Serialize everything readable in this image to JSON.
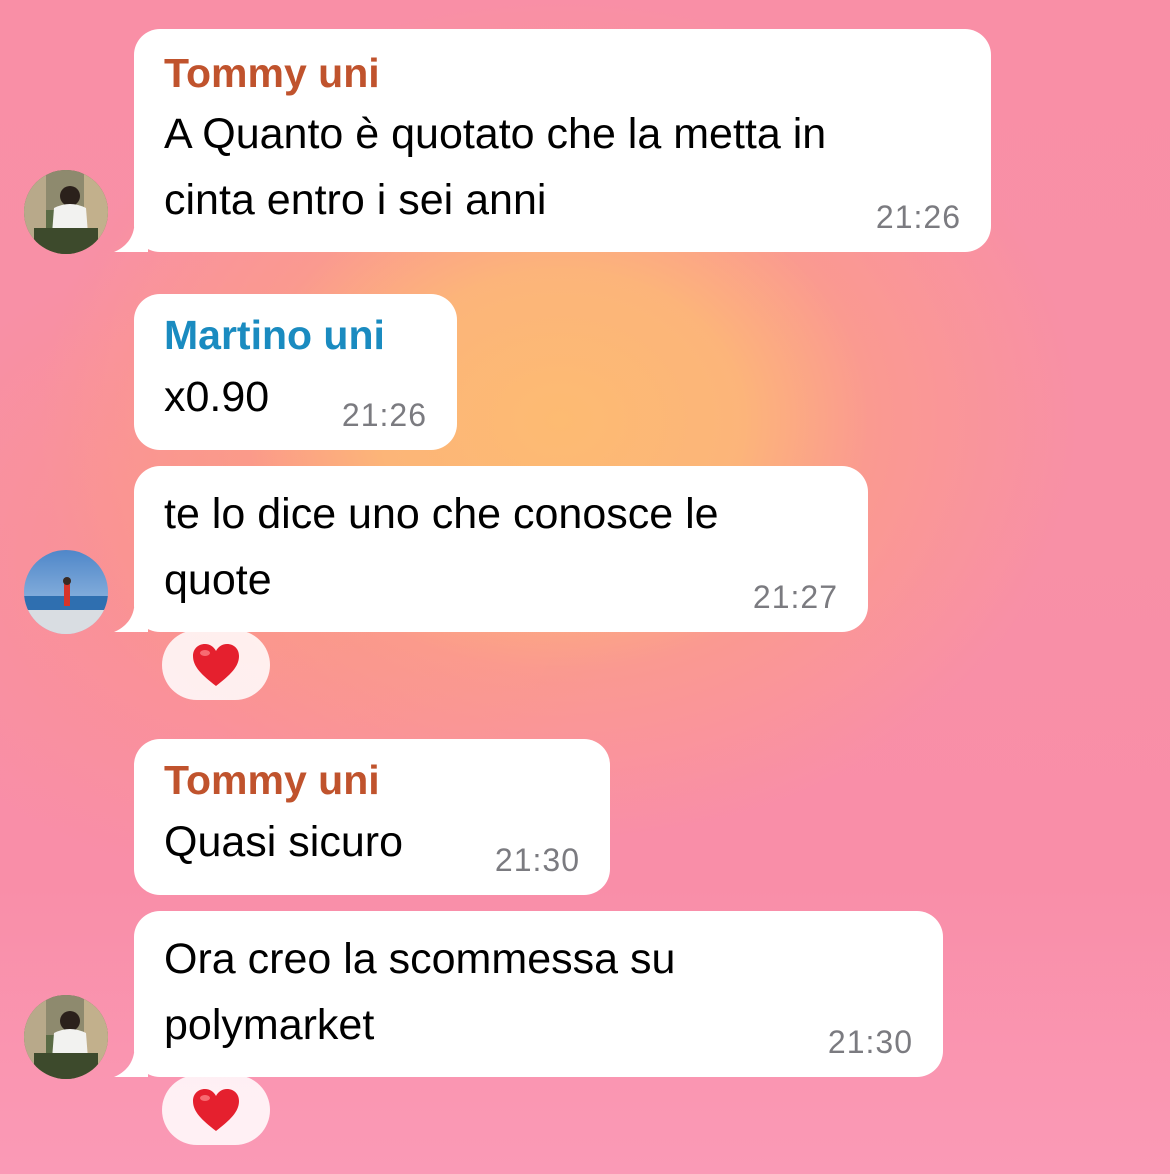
{
  "colors": {
    "tommy_name": "#c0532d",
    "martino_name": "#1a8bc0",
    "reaction_heart": "#e5202e"
  },
  "messages": [
    {
      "sender": "Tommy uni",
      "lines": [
        "A Quanto è quotato che la metta in",
        "cinta entro i sei anni"
      ],
      "time": "21:26"
    },
    {
      "sender": "Martino uni",
      "lines": [
        "x0.90"
      ],
      "time": "21:26"
    },
    {
      "sender": "",
      "lines": [
        "te lo dice uno che conosce le",
        "quote"
      ],
      "time": "21:27",
      "reaction": "heart-emoji"
    },
    {
      "sender": "Tommy uni",
      "lines": [
        "Quasi sicuro"
      ],
      "time": "21:30"
    },
    {
      "sender": "",
      "lines": [
        "Ora creo la scommessa su",
        "polymarket"
      ],
      "time": "21:30",
      "reaction": "heart-emoji"
    }
  ]
}
